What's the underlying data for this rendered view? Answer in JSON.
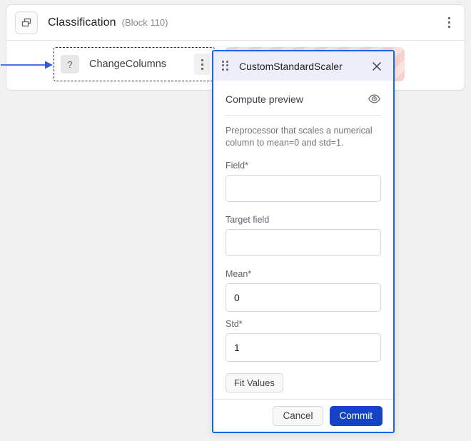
{
  "block": {
    "icon": "copy-blocks-icon",
    "title": "Classification",
    "subtitle": "(Block 110)",
    "menu_icon": "vertical-dots-icon"
  },
  "canvas": {
    "connector_color": "#4876d6",
    "nodes": [
      {
        "badge": "?",
        "label": "ChangeColumns",
        "menu_icon": "vertical-dots-icon",
        "style": "dashed-selected"
      },
      {
        "badge": "",
        "label": "",
        "menu_icon": "vertical-dots-icon",
        "style": "error-hatched",
        "color": "#f6d3d1"
      }
    ]
  },
  "dialog": {
    "drag_handle_icon": "drag-handle-icon",
    "title": "CustomStandardScaler",
    "close_icon": "close-icon",
    "accent_color": "#1667e8",
    "header_bg": "#eeeefb",
    "preview": {
      "label": "Compute preview",
      "icon": "eye-icon"
    },
    "description": "Preprocessor that scales a numerical column to mean=0 and std=1.",
    "fields": [
      {
        "label": "Field*",
        "value": "",
        "placeholder": ""
      },
      {
        "label": "Target field",
        "value": "",
        "placeholder": ""
      },
      {
        "label": "Mean*",
        "value": "0",
        "placeholder": ""
      },
      {
        "label": "Std*",
        "value": "1",
        "placeholder": ""
      }
    ],
    "fit_button_label": "Fit Values",
    "footer": {
      "cancel_label": "Cancel",
      "commit_label": "Commit",
      "commit_color": "#1543c4"
    }
  }
}
